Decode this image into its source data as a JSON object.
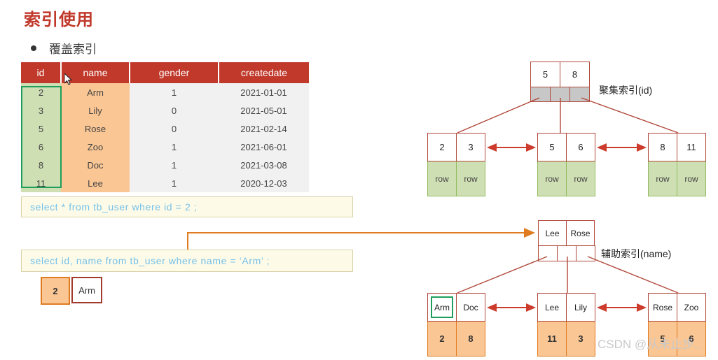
{
  "heading": {
    "title": "索引使用",
    "bullet": "覆盖索引"
  },
  "table": {
    "columns": [
      "id",
      "name",
      "gender",
      "createdate"
    ],
    "rows": [
      {
        "id": "2",
        "name": "Arm",
        "gender": "1",
        "createdate": "2021-01-01"
      },
      {
        "id": "3",
        "name": "Lily",
        "gender": "0",
        "createdate": "2021-05-01"
      },
      {
        "id": "5",
        "name": "Rose",
        "gender": "0",
        "createdate": "2021-02-14"
      },
      {
        "id": "6",
        "name": "Zoo",
        "gender": "1",
        "createdate": "2021-06-01"
      },
      {
        "id": "8",
        "name": "Doc",
        "gender": "1",
        "createdate": "2021-03-08"
      },
      {
        "id": "11",
        "name": "Lee",
        "gender": "1",
        "createdate": "2020-12-03"
      }
    ]
  },
  "sql": {
    "query_one": "select * from  tb_user  where  id = 2 ;",
    "query_two": "select  id, name  from  tb_user  where  name = ‘Arm’ ;"
  },
  "result": {
    "id": "2",
    "name": "Arm"
  },
  "clustered_index": {
    "label": "聚集索引(id)",
    "root_keys": [
      "5",
      "8"
    ],
    "leaves": [
      {
        "keys": [
          "2",
          "3"
        ],
        "values": [
          "row",
          "row"
        ]
      },
      {
        "keys": [
          "5",
          "6"
        ],
        "values": [
          "row",
          "row"
        ]
      },
      {
        "keys": [
          "8",
          "11"
        ],
        "values": [
          "row",
          "row"
        ]
      }
    ]
  },
  "secondary_index": {
    "label": "辅助索引(name)",
    "root_keys": [
      "Lee",
      "Rose"
    ],
    "leaves": [
      {
        "keys": [
          "Arm",
          "Doc"
        ],
        "values": [
          "2",
          "8"
        ]
      },
      {
        "keys": [
          "Lee",
          "Lily"
        ],
        "values": [
          "11",
          "3"
        ]
      },
      {
        "keys": [
          "Rose",
          "Zoo"
        ],
        "values": [
          "5",
          "6"
        ]
      }
    ],
    "highlighted_key": "Arm"
  },
  "watermark": "CSDN @从未止步..",
  "colors": {
    "title_red": "#c0392b",
    "header_red": "#c0392b",
    "id_green": "#cfdfb4",
    "name_orange": "#fac694",
    "node_border": "#b1483a",
    "arrow_red": "#cc3b2b",
    "connector_orange": "#e07b20",
    "highlight_green": "#1e9e5a",
    "sql_text_blue": "#76c0e8"
  }
}
